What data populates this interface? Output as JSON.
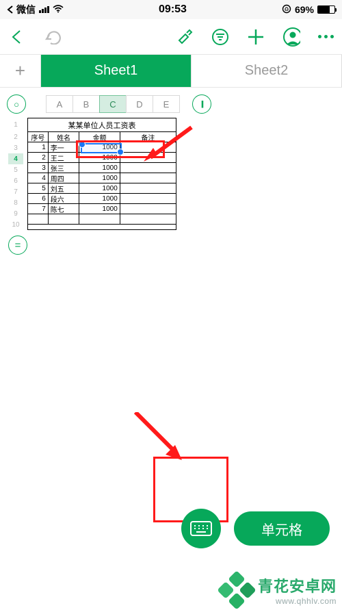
{
  "status": {
    "app_back": "微信",
    "time": "09:53",
    "battery_text": "69%"
  },
  "tabs": {
    "sheet1": "Sheet1",
    "sheet2": "Sheet2"
  },
  "columns": {
    "a": "A",
    "b": "B",
    "c": "C",
    "d": "D",
    "e": "E"
  },
  "pause_glyph": "||",
  "rec_glyph": "○",
  "rows": {
    "r1": "1",
    "r2": "2",
    "r3": "3",
    "r4": "4",
    "r5": "5",
    "r6": "6",
    "r7": "7",
    "r8": "8",
    "r9": "9",
    "r10": "10"
  },
  "sheet_title": "某某单位人员工资表",
  "headers": {
    "num": "序号",
    "name": "姓名",
    "amount": "金额",
    "note": "备注"
  },
  "data": [
    {
      "n": "1",
      "name": "李一",
      "amt": "1000",
      "note": ""
    },
    {
      "n": "2",
      "name": "王二",
      "amt": "1000",
      "note": ""
    },
    {
      "n": "3",
      "name": "张三",
      "amt": "1000",
      "note": ""
    },
    {
      "n": "4",
      "name": "周四",
      "amt": "1000",
      "note": ""
    },
    {
      "n": "5",
      "name": "刘五",
      "amt": "1000",
      "note": ""
    },
    {
      "n": "6",
      "name": "段六",
      "amt": "1000",
      "note": ""
    },
    {
      "n": "7",
      "name": "陈七",
      "amt": "1000",
      "note": ""
    }
  ],
  "formula_glyph": "=",
  "pill_label": "单元格",
  "watermark": {
    "name": "青花安卓网",
    "url": "www.qhhlv.com"
  }
}
